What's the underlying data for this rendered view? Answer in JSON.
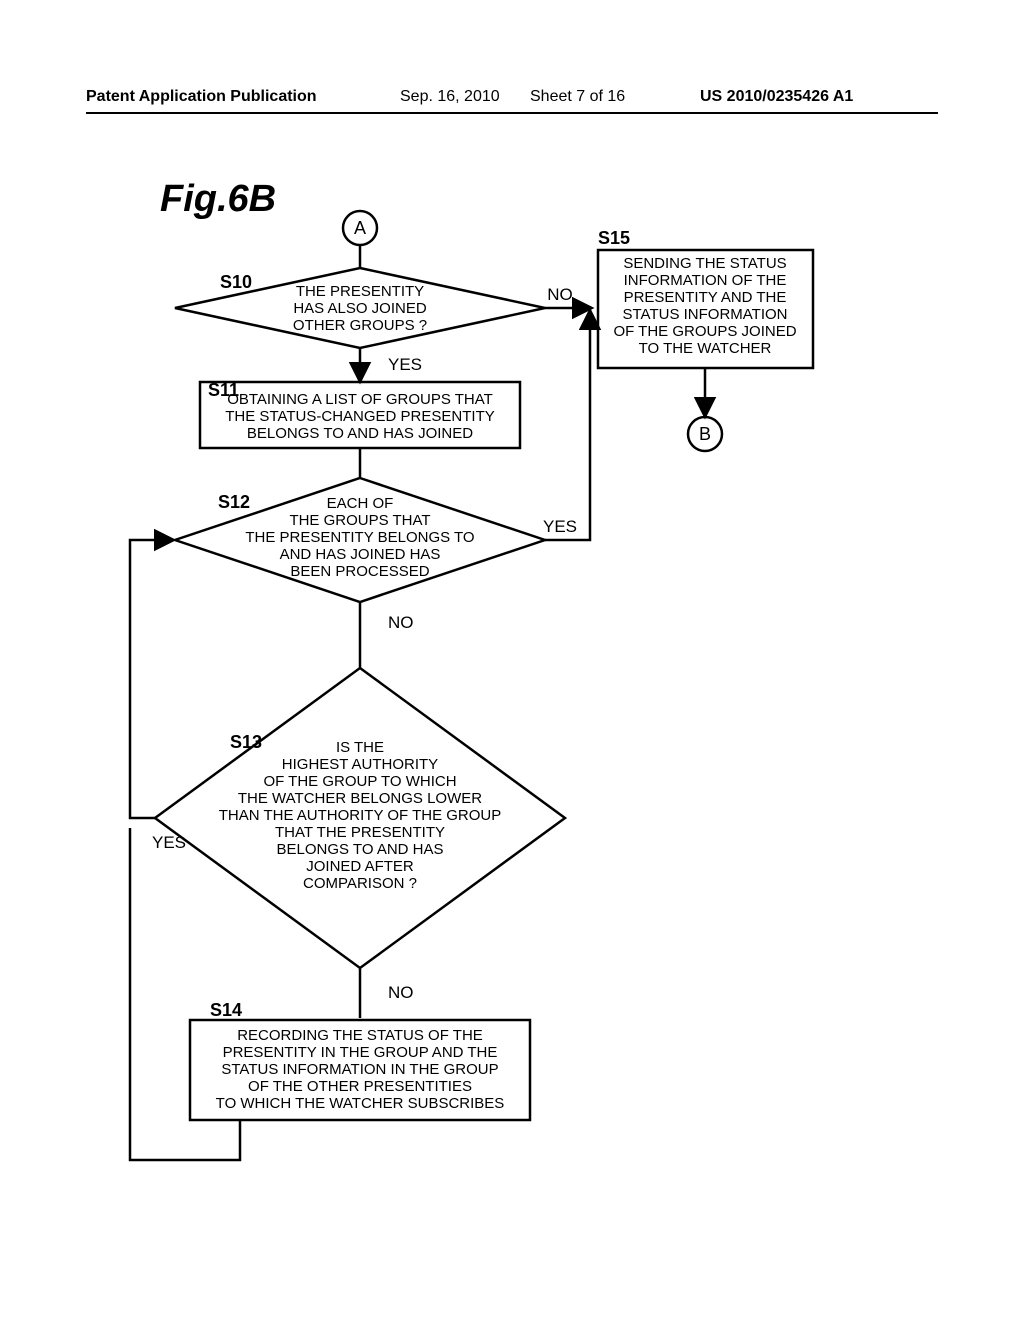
{
  "header": {
    "publication_label": "Patent Application Publication",
    "date": "Sep. 16, 2010",
    "sheet": "Sheet 7 of 16",
    "pubnum": "US 2010/0235426 A1"
  },
  "figure_label": "Fig.6B",
  "connectors": {
    "a": "A",
    "b": "B"
  },
  "steps": {
    "s10": {
      "id": "S10",
      "text": "THE PRESENTITY\nHAS ALSO JOINED\nOTHER GROUPS ?",
      "no": "NO",
      "yes": "YES"
    },
    "s11": {
      "id": "S11",
      "text": "OBTAINING A LIST OF GROUPS THAT\nTHE STATUS-CHANGED PRESENTITY\nBELONGS TO AND HAS JOINED"
    },
    "s12": {
      "id": "S12",
      "text": "EACH OF\nTHE GROUPS THAT\nTHE PRESENTITY BELONGS TO\nAND HAS JOINED HAS\nBEEN PROCESSED",
      "yes": "YES",
      "no": "NO"
    },
    "s13": {
      "id": "S13",
      "text": "IS THE\nHIGHEST AUTHORITY\nOF THE GROUP TO WHICH\nTHE WATCHER BELONGS LOWER\nTHAN THE AUTHORITY OF THE GROUP\nTHAT THE PRESENTITY\nBELONGS TO AND HAS\nJOINED AFTER\nCOMPARISON ?",
      "yes": "YES",
      "no": "NO"
    },
    "s14": {
      "id": "S14",
      "text": "RECORDING THE STATUS OF THE\nPRESENTITY IN THE GROUP AND THE\nSTATUS INFORMATION IN THE GROUP\nOF THE OTHER PRESENTITIES\nTO WHICH THE WATCHER SUBSCRIBES"
    },
    "s15": {
      "id": "S15",
      "text": "SENDING THE STATUS\nINFORMATION OF THE\nPRESENTITY AND THE\nSTATUS INFORMATION\nOF THE GROUPS JOINED\nTO THE WATCHER"
    }
  }
}
